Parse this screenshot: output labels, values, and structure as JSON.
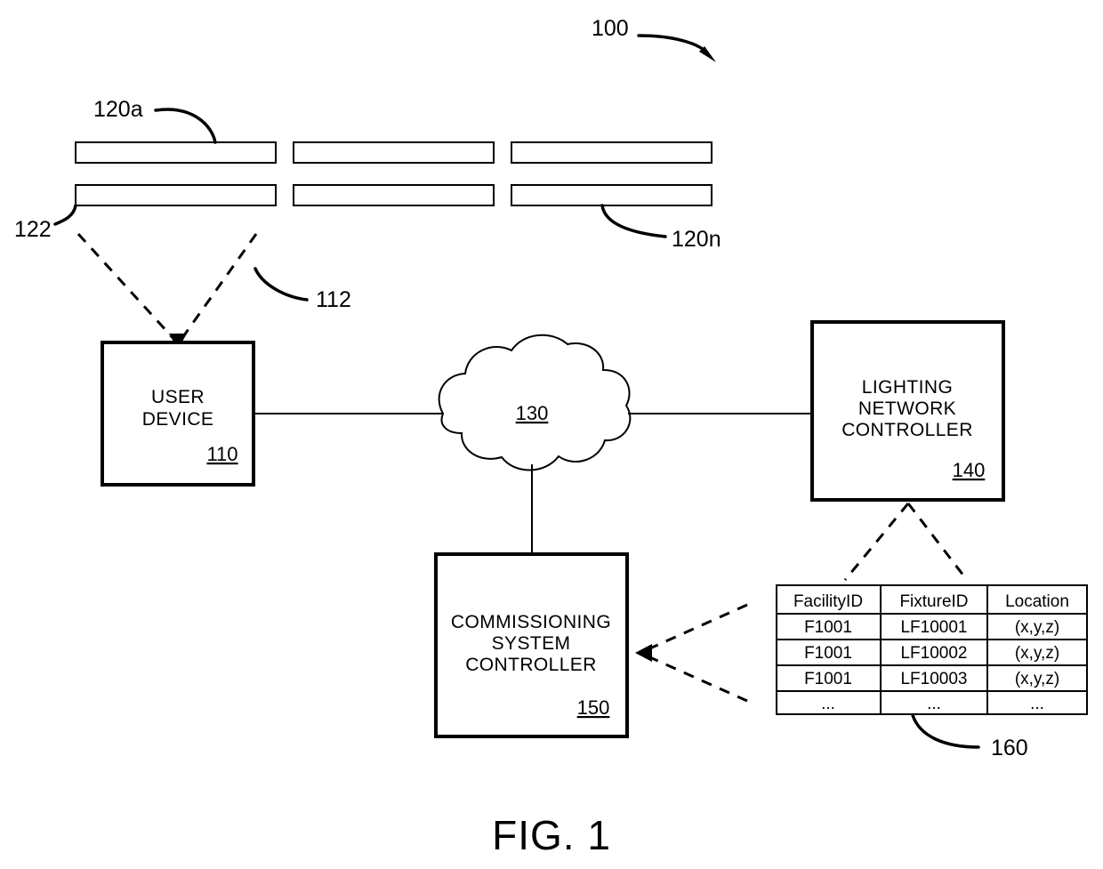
{
  "figure": {
    "caption": "FIG. 1",
    "system_ref": "100"
  },
  "fixtures": {
    "first_ref": "120a",
    "last_ref": "120n",
    "detail_ref": "122",
    "capture_ref": "112",
    "count": 6
  },
  "nodes": {
    "user_device": {
      "line1": "USER",
      "line2": "DEVICE",
      "ref": "110"
    },
    "network_cloud": {
      "ref": "130"
    },
    "lighting_network_controller": {
      "line1": "LIGHTING",
      "line2": "NETWORK",
      "line3": "CONTROLLER",
      "ref": "140"
    },
    "commissioning_system_controller": {
      "line1": "COMMISSIONING",
      "line2": "SYSTEM",
      "line3": "CONTROLLER",
      "ref": "150"
    }
  },
  "table": {
    "ref": "160",
    "headers": [
      "FacilityID",
      "FixtureID",
      "Location"
    ],
    "rows": [
      [
        "F1001",
        "LF10001",
        "(x,y,z)"
      ],
      [
        "F1001",
        "LF10002",
        "(x,y,z)"
      ],
      [
        "F1001",
        "LF10003",
        "(x,y,z)"
      ],
      [
        "...",
        "...",
        "..."
      ]
    ]
  },
  "colors": {
    "ink": "#000000",
    "paper": "#ffffff"
  }
}
